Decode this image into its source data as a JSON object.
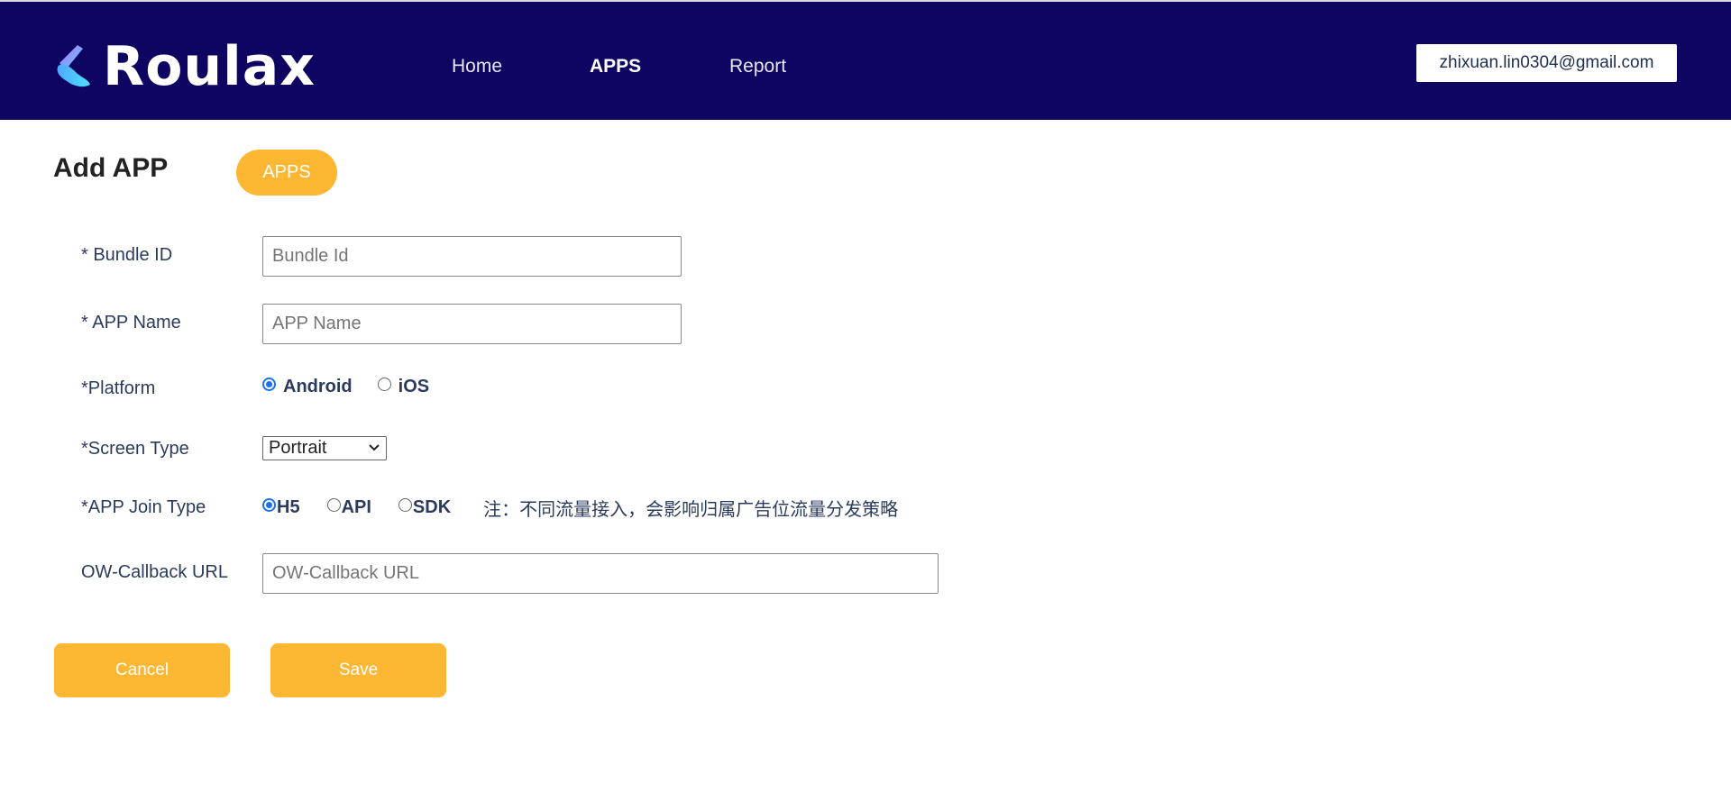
{
  "brand": {
    "name": "Roulax"
  },
  "nav": {
    "items": [
      {
        "label": "Home",
        "active": false
      },
      {
        "label": "APPS",
        "active": true
      },
      {
        "label": "Report",
        "active": false
      }
    ]
  },
  "user": {
    "email": "zhixuan.lin0304@gmail.com"
  },
  "page": {
    "title": "Add APP",
    "section_pill": "APPS"
  },
  "form": {
    "bundle_id": {
      "label": "* Bundle ID",
      "placeholder": "Bundle Id",
      "value": ""
    },
    "app_name": {
      "label": "* APP Name",
      "placeholder": "APP Name",
      "value": ""
    },
    "platform": {
      "label": "*Platform",
      "options": [
        "Android",
        "iOS"
      ],
      "selected": "Android"
    },
    "screen_type": {
      "label": "*Screen Type",
      "value": "Portrait"
    },
    "join_type": {
      "label": "*APP Join Type",
      "options": [
        "H5",
        "API",
        "SDK"
      ],
      "selected": "H5",
      "note": "注：不同流量接入，会影响归属广告位流量分发策略"
    },
    "callback_url": {
      "label": "OW-Callback URL",
      "placeholder": "OW-Callback URL",
      "value": ""
    }
  },
  "actions": {
    "cancel_label": "Cancel",
    "save_label": "Save"
  },
  "colors": {
    "header_bg": "#0e0462",
    "accent": "#fdb733",
    "radio_checked": "#1a73e8"
  }
}
